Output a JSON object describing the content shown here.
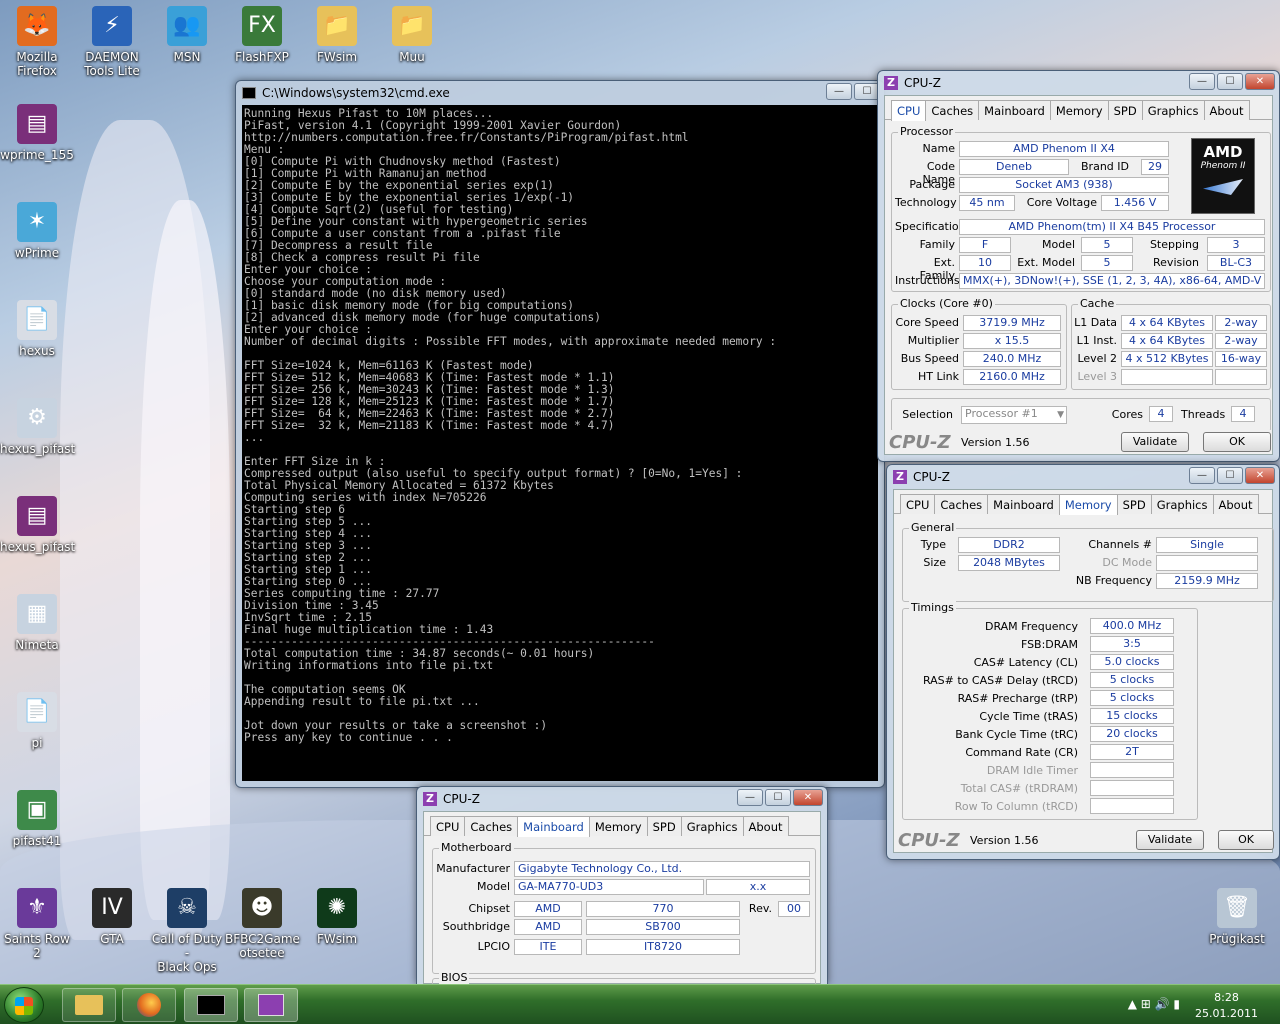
{
  "desktop": {
    "icons": [
      {
        "label": "Mozilla\nFirefox",
        "glyph": "🦊",
        "color": "#e26b1f"
      },
      {
        "label": "DAEMON\nTools Lite",
        "glyph": "⚡",
        "color": "#2a64b8"
      },
      {
        "label": "MSN",
        "glyph": "👥",
        "color": "#3aa0d8"
      },
      {
        "label": "FlashFXP",
        "glyph": "FX",
        "color": "#3a7a3a"
      },
      {
        "label": "FWsim",
        "glyph": "📁",
        "color": "#e7c15a"
      },
      {
        "label": "Muu",
        "glyph": "📁",
        "color": "#e7c15a"
      },
      {
        "label": "wprime_155",
        "glyph": "▤",
        "color": "#7a2f7a"
      },
      {
        "label": "wPrime",
        "glyph": "✶",
        "color": "#4aa8d8"
      },
      {
        "label": "hexus",
        "glyph": "📄",
        "color": "#d8dde5"
      },
      {
        "label": "hexus_pifast",
        "glyph": "⚙",
        "color": "#c7d3e0"
      },
      {
        "label": "hexus_pifast",
        "glyph": "▤",
        "color": "#7a2f7a"
      },
      {
        "label": "Nimeta",
        "glyph": "▦",
        "color": "#c7d3e0"
      },
      {
        "label": "pi",
        "glyph": "📄",
        "color": "#d8dde5"
      },
      {
        "label": "pifast41",
        "glyph": "▣",
        "color": "#3e8a4a"
      },
      {
        "label": "Saints Row 2",
        "glyph": "⚜",
        "color": "#6a3a9a"
      },
      {
        "label": "GTA",
        "glyph": "IV",
        "color": "#2a2a2a"
      },
      {
        "label": "Call of Duty -\nBlack Ops",
        "glyph": "☠",
        "color": "#1e3e66"
      },
      {
        "label": "BFBC2Game\notsetee",
        "glyph": "☻",
        "color": "#3a3a2a"
      },
      {
        "label": "FWsim",
        "glyph": "✺",
        "color": "#0f3a1a"
      },
      {
        "label": "Prügikast",
        "glyph": "🗑",
        "color": "#b8c6d4"
      }
    ]
  },
  "cmd": {
    "title": "C:\\Windows\\system32\\cmd.exe",
    "lines": [
      "Running Hexus Pifast to 10M places...",
      "PiFast, version 4.1 (Copyright 1999-2001 Xavier Gourdon)",
      "http://numbers.computation.free.fr/Constants/PiProgram/pifast.html",
      "Menu :",
      "[0] Compute Pi with Chudnovsky method (Fastest)",
      "[1] Compute Pi with Ramanujan method",
      "[2] Compute E by the exponential series exp(1)",
      "[3] Compute E by the exponential series 1/exp(-1)",
      "[4] Compute Sqrt(2) (useful for testing)",
      "[5] Define your constant with hypergeometric series",
      "[6] Compute a user constant from a .pifast file",
      "[7] Decompress a result file",
      "[8] Check a compress result Pi file",
      "Enter your choice :",
      "Choose your computation mode :",
      "[0] standard mode (no disk memory used)",
      "[1] basic disk memory mode (for big computations)",
      "[2] advanced disk memory mode (for huge computations)",
      "Enter your choice :",
      "Number of decimal digits : Possible FFT modes, with approximate needed memory :",
      "",
      "FFT Size=1024 k, Mem=61163 K (Fastest mode)",
      "FFT Size= 512 k, Mem=40683 K (Time: Fastest mode * 1.1)",
      "FFT Size= 256 k, Mem=30243 K (Time: Fastest mode * 1.3)",
      "FFT Size= 128 k, Mem=25123 K (Time: Fastest mode * 1.7)",
      "FFT Size=  64 k, Mem=22463 K (Time: Fastest mode * 2.7)",
      "FFT Size=  32 k, Mem=21183 K (Time: Fastest mode * 4.7)",
      "...",
      "",
      "Enter FFT Size in k :",
      "Compressed output (also useful to specify output format) ? [0=No, 1=Yes] :",
      "Total Physical Memory Allocated = 61372 Kbytes",
      "Computing series with index N=705226",
      "Starting step 6",
      "Starting step 5 ...",
      "Starting step 4 ...",
      "Starting step 3 ...",
      "Starting step 2 ...",
      "Starting step 1 ...",
      "Starting step 0 ...",
      "Series computing time : 27.77",
      "Division time : 3.45",
      "InvSqrt time : 2.15",
      "Final huge multiplication time : 1.43",
      "-------------------------------------------------------------",
      "Total computation time : 34.87 seconds(~ 0.01 hours)",
      "Writing informations into file pi.txt",
      "",
      "The computation seems OK",
      "Appending result to file pi.txt ...",
      "",
      "Jot down your results or take a screenshot :)",
      "Press any key to continue . . ."
    ]
  },
  "cpuz_common": {
    "title": "CPU-Z",
    "tabs": [
      "CPU",
      "Caches",
      "Mainboard",
      "Memory",
      "SPD",
      "Graphics",
      "About"
    ],
    "logo": "CPU-Z",
    "version": "Version 1.56",
    "validate": "Validate",
    "ok": "OK",
    "min": "—",
    "max": "☐",
    "close": "✕"
  },
  "cpuz_cpu": {
    "group_processor": "Processor",
    "name_l": "Name",
    "name": "AMD Phenom II X4",
    "code_l": "Code Name",
    "code": "Deneb",
    "brand_l": "Brand ID",
    "brand": "29",
    "pkg_l": "Package",
    "pkg": "Socket AM3 (938)",
    "tech_l": "Technology",
    "tech": "45 nm",
    "volt_l": "Core Voltage",
    "volt": "1.456 V",
    "spec_l": "Specification",
    "spec": "AMD Phenom(tm) II X4 B45 Processor",
    "fam_l": "Family",
    "fam": "F",
    "model_l": "Model",
    "model": "5",
    "step_l": "Stepping",
    "step": "3",
    "efam_l": "Ext. Family",
    "efam": "10",
    "emodel_l": "Ext. Model",
    "emodel": "5",
    "rev_l": "Revision",
    "rev": "BL-C3",
    "instr_l": "Instructions",
    "instr": "MMX(+), 3DNow!(+), SSE (1, 2, 3, 4A), x86-64, AMD-V",
    "logo_brand": "AMD",
    "logo_sub": "Phenom II",
    "group_clocks": "Clocks (Core #0)",
    "cs_l": "Core Speed",
    "cs": "3719.9 MHz",
    "mult_l": "Multiplier",
    "mult": "x 15.5",
    "bus_l": "Bus Speed",
    "bus": "240.0 MHz",
    "ht_l": "HT Link",
    "ht": "2160.0 MHz",
    "group_cache": "Cache",
    "l1d_l": "L1 Data",
    "l1d": "4 x 64 KBytes",
    "l1d_w": "2-way",
    "l1i_l": "L1 Inst.",
    "l1i": "4 x 64 KBytes",
    "l1i_w": "2-way",
    "l2_l": "Level 2",
    "l2": "4 x 512 KBytes",
    "l2_w": "16-way",
    "l3_l": "Level 3",
    "sel_l": "Selection",
    "sel": "Processor #1",
    "cores_l": "Cores",
    "cores": "4",
    "threads_l": "Threads",
    "threads": "4"
  },
  "cpuz_mem": {
    "group_general": "General",
    "type_l": "Type",
    "type": "DDR2",
    "size_l": "Size",
    "size": "2048 MBytes",
    "ch_l": "Channels #",
    "ch": "Single",
    "dc_l": "DC Mode",
    "nb_l": "NB Frequency",
    "nb": "2159.9 MHz",
    "group_timings": "Timings",
    "rows": [
      {
        "l": "DRAM Frequency",
        "v": "400.0 MHz"
      },
      {
        "l": "FSB:DRAM",
        "v": "3:5"
      },
      {
        "l": "CAS# Latency (CL)",
        "v": "5.0 clocks"
      },
      {
        "l": "RAS# to CAS# Delay (tRCD)",
        "v": "5 clocks"
      },
      {
        "l": "RAS# Precharge (tRP)",
        "v": "5 clocks"
      },
      {
        "l": "Cycle Time (tRAS)",
        "v": "15 clocks"
      },
      {
        "l": "Bank Cycle Time (tRC)",
        "v": "20 clocks"
      },
      {
        "l": "Command Rate (CR)",
        "v": "2T"
      },
      {
        "l": "DRAM Idle Timer",
        "v": ""
      },
      {
        "l": "Total CAS# (tRDRAM)",
        "v": ""
      },
      {
        "l": "Row To Column (tRCD)",
        "v": ""
      }
    ]
  },
  "cpuz_mb": {
    "group_mb": "Motherboard",
    "man_l": "Manufacturer",
    "man": "Gigabyte Technology Co., Ltd.",
    "model_l": "Model",
    "model": "GA-MA770-UD3",
    "model_rev": "x.x",
    "chip_l": "Chipset",
    "chip_a": "AMD",
    "chip_b": "770",
    "rev_l": "Rev.",
    "rev": "00",
    "sb_l": "Southbridge",
    "sb_a": "AMD",
    "sb_b": "SB700",
    "lpcio_l": "LPCIO",
    "lpcio_a": "ITE",
    "lpcio_b": "IT8720",
    "group_bios": "BIOS"
  },
  "taskbar": {
    "time": "8:28",
    "date": "25.01.2011",
    "tray": "▲  ⊞  🔊  ▮"
  }
}
